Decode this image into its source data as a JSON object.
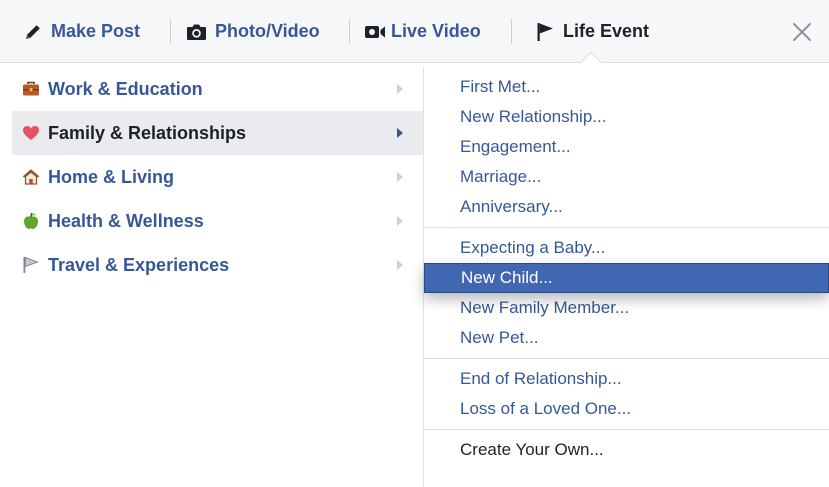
{
  "composer": {
    "tabs": [
      {
        "label": "Make Post",
        "icon": "pencil-icon"
      },
      {
        "label": "Photo/Video",
        "icon": "camera-icon"
      },
      {
        "label": "Live Video",
        "icon": "video-camera-icon"
      },
      {
        "label": "Life Event",
        "icon": "flag-icon",
        "active": true
      }
    ],
    "close_icon": "close-icon"
  },
  "categories": [
    {
      "label": "Work & Education",
      "icon": "briefcase-icon"
    },
    {
      "label": "Family & Relationships",
      "icon": "heart-icon",
      "selected": true
    },
    {
      "label": "Home & Living",
      "icon": "house-icon"
    },
    {
      "label": "Health & Wellness",
      "icon": "apple-icon"
    },
    {
      "label": "Travel & Experiences",
      "icon": "flag-icon"
    }
  ],
  "events": {
    "groups": [
      [
        "First Met...",
        "New Relationship...",
        "Engagement...",
        "Marriage...",
        "Anniversary..."
      ],
      [
        "Expecting a Baby...",
        "New Child...",
        "New Family Member...",
        "New Pet..."
      ],
      [
        "End of Relationship...",
        "Loss of a Loved One..."
      ],
      [
        "Create Your Own..."
      ]
    ],
    "highlighted": "New Child..."
  },
  "colors": {
    "link": "#365899",
    "text": "#1d2129",
    "highlight": "#4267b2",
    "selected_row": "#e9ebee",
    "tabbar_bg": "#f6f7f9",
    "border": "#dddfe2"
  }
}
